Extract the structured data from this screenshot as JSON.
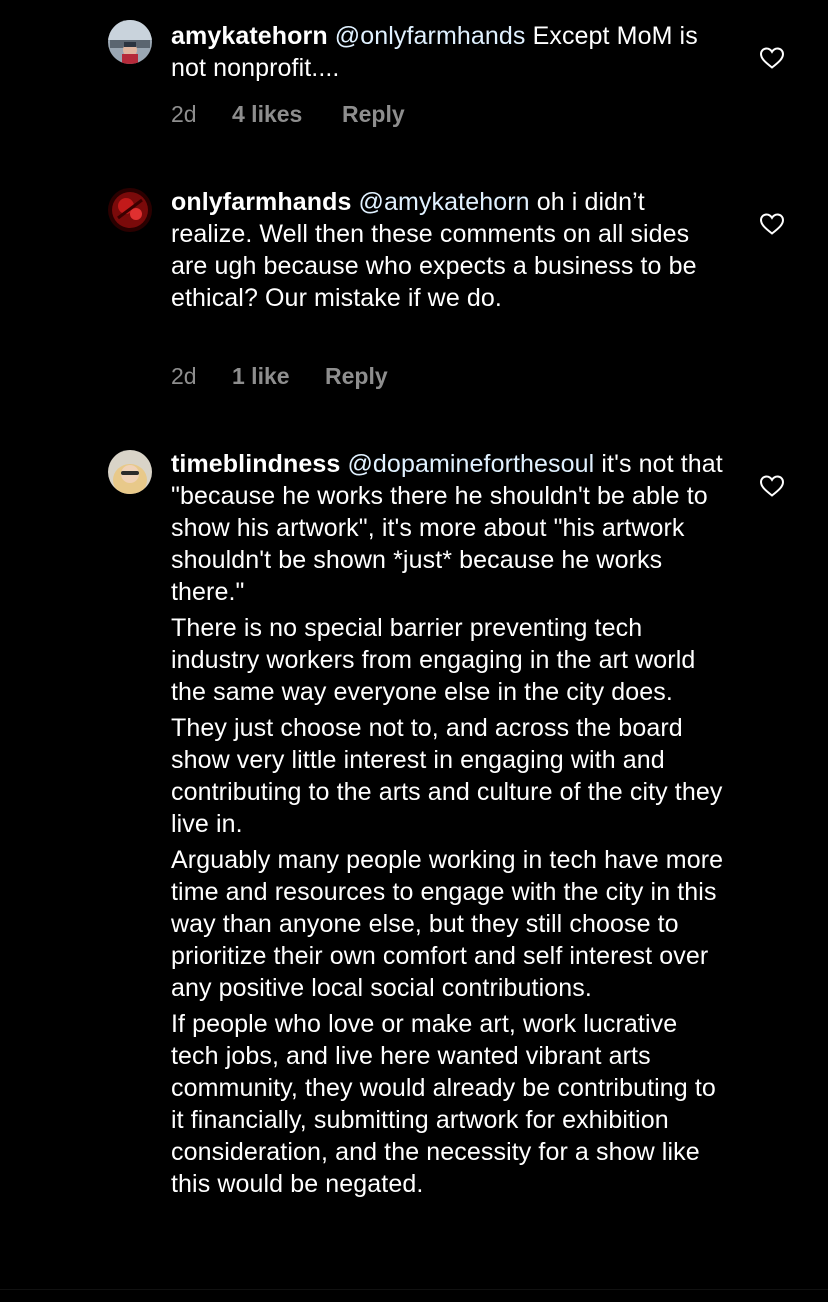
{
  "comments": [
    {
      "username": "amykatehorn",
      "mention": "@onlyfarmhands",
      "paragraphs": [
        "Except MoM is not nonprofit...."
      ],
      "time": "2d",
      "likes": "4 likes",
      "reply": "Reply"
    },
    {
      "username": "onlyfarmhands",
      "mention": "@amykatehorn",
      "paragraphs": [
        "oh i didn’t realize. Well then these comments on all sides are ugh because who expects a business to be ethical? Our mistake if we do."
      ],
      "time": "2d",
      "likes": "1 like",
      "reply": "Reply"
    },
    {
      "username": "timeblindness",
      "mention": "@dopamineforthesoul",
      "paragraphs": [
        "it's not that \"because he works there he shouldn't be able to show his artwork\", it's more about \"his artwork shouldn't be shown *just* because he works there.\"",
        "There is no special barrier preventing tech industry workers from engaging in the art world the same way everyone else in the city does.",
        "They just choose not to, and across the board show very little interest in engaging with and contributing to the arts and culture of the city they live in.",
        "Arguably many people working in tech have more time and resources to engage with the city in this way than anyone else, but they still choose to prioritize their own comfort and self interest over any positive local social contributions.",
        "If people who love or make art, work lucrative tech jobs, and live here wanted vibrant arts community, they would already be contributing to it financially, submitting artwork for exhibition consideration, and the necessity for a show like this would be negated."
      ]
    }
  ],
  "icons": {
    "like": "heart-outline-icon"
  },
  "colors": {
    "background": "#000000",
    "text": "#ffffff",
    "secondary": "#8e8e8e"
  }
}
